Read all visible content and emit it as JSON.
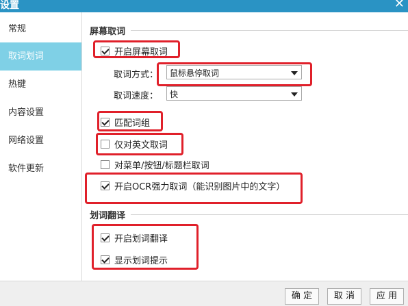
{
  "window": {
    "title": "设置",
    "close_glyph": "✕"
  },
  "sidebar": {
    "items": [
      {
        "label": "常规",
        "active": false
      },
      {
        "label": "取词划词",
        "active": true
      },
      {
        "label": "热键",
        "active": false
      },
      {
        "label": "内容设置",
        "active": false
      },
      {
        "label": "网络设置",
        "active": false
      },
      {
        "label": "软件更新",
        "active": false
      }
    ]
  },
  "capture": {
    "section_title": "屏幕取词",
    "enable_label": "开启屏幕取词",
    "enable_checked": true,
    "mode_label": "取词方式：",
    "mode_value": "鼠标悬停取词",
    "speed_label": "取词速度：",
    "speed_value": "快",
    "match_phrase_label": "匹配词组",
    "match_phrase_checked": true,
    "english_only_label": "仅对英文取词",
    "english_only_checked": false,
    "menu_buttons_label": "对菜单/按钮/标题栏取词",
    "menu_buttons_checked": false,
    "ocr_label": "开启OCR强力取词（能识别图片中的文字）",
    "ocr_checked": true
  },
  "selection": {
    "section_title": "划词翻译",
    "enable_label": "开启划词翻译",
    "enable_checked": true,
    "hint_label": "显示划词提示",
    "hint_checked": true
  },
  "footer": {
    "ok_label": "确 定",
    "cancel_label": "取 消",
    "apply_label": "应 用"
  },
  "colors": {
    "titlebar": "#2a93c4",
    "active_nav": "#7fd0e6",
    "highlight": "#e0202a"
  }
}
